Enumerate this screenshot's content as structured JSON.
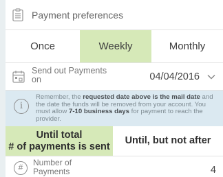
{
  "payment_preferences": {
    "label": "Payment preferences",
    "icon": "clipboard-icon"
  },
  "frequency": {
    "options": [
      {
        "label": "Once",
        "selected": false
      },
      {
        "label": "Weekly",
        "selected": true
      },
      {
        "label": "Monthly",
        "selected": false
      }
    ],
    "selected_color": "#d6e9b8"
  },
  "send_out": {
    "label_line1": "Send out Payments",
    "label_line2": "on",
    "value": "04/04/2016",
    "icon": "calendar-icon",
    "chevron": "chevron-down-icon"
  },
  "info": {
    "icon": "info-icon",
    "text_1": "Remember, the ",
    "text_2": "requested date above is the mail date",
    "text_3": " and the date the funds will be removed from your account. You must allow ",
    "text_4": "7-10 business days",
    "text_5": " for payment to reach the provider.",
    "background": "#dbe9f1"
  },
  "stop_condition": {
    "options": [
      {
        "line1": "Until total",
        "line2": "# of payments is sent",
        "selected": true
      },
      {
        "line1": "Until, but not after",
        "selected": false
      }
    ]
  },
  "number_of_payments": {
    "label_line1": "Number of",
    "label_line2": "Payments",
    "value": "4",
    "icon": "hash-icon"
  }
}
